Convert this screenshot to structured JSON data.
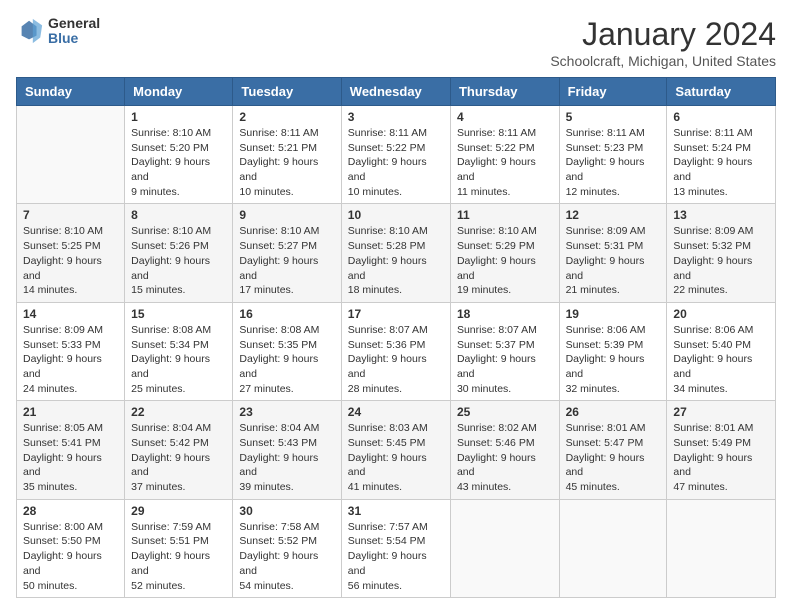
{
  "header": {
    "logo": {
      "general": "General",
      "blue": "Blue"
    },
    "title": "January 2024",
    "location": "Schoolcraft, Michigan, United States"
  },
  "calendar": {
    "weekdays": [
      "Sunday",
      "Monday",
      "Tuesday",
      "Wednesday",
      "Thursday",
      "Friday",
      "Saturday"
    ],
    "weeks": [
      [
        {
          "day": "",
          "sunrise": "",
          "sunset": "",
          "daylight": ""
        },
        {
          "day": "1",
          "sunrise": "Sunrise: 8:10 AM",
          "sunset": "Sunset: 5:20 PM",
          "daylight": "Daylight: 9 hours and 9 minutes."
        },
        {
          "day": "2",
          "sunrise": "Sunrise: 8:11 AM",
          "sunset": "Sunset: 5:21 PM",
          "daylight": "Daylight: 9 hours and 10 minutes."
        },
        {
          "day": "3",
          "sunrise": "Sunrise: 8:11 AM",
          "sunset": "Sunset: 5:22 PM",
          "daylight": "Daylight: 9 hours and 10 minutes."
        },
        {
          "day": "4",
          "sunrise": "Sunrise: 8:11 AM",
          "sunset": "Sunset: 5:22 PM",
          "daylight": "Daylight: 9 hours and 11 minutes."
        },
        {
          "day": "5",
          "sunrise": "Sunrise: 8:11 AM",
          "sunset": "Sunset: 5:23 PM",
          "daylight": "Daylight: 9 hours and 12 minutes."
        },
        {
          "day": "6",
          "sunrise": "Sunrise: 8:11 AM",
          "sunset": "Sunset: 5:24 PM",
          "daylight": "Daylight: 9 hours and 13 minutes."
        }
      ],
      [
        {
          "day": "7",
          "sunrise": "Sunrise: 8:10 AM",
          "sunset": "Sunset: 5:25 PM",
          "daylight": "Daylight: 9 hours and 14 minutes."
        },
        {
          "day": "8",
          "sunrise": "Sunrise: 8:10 AM",
          "sunset": "Sunset: 5:26 PM",
          "daylight": "Daylight: 9 hours and 15 minutes."
        },
        {
          "day": "9",
          "sunrise": "Sunrise: 8:10 AM",
          "sunset": "Sunset: 5:27 PM",
          "daylight": "Daylight: 9 hours and 17 minutes."
        },
        {
          "day": "10",
          "sunrise": "Sunrise: 8:10 AM",
          "sunset": "Sunset: 5:28 PM",
          "daylight": "Daylight: 9 hours and 18 minutes."
        },
        {
          "day": "11",
          "sunrise": "Sunrise: 8:10 AM",
          "sunset": "Sunset: 5:29 PM",
          "daylight": "Daylight: 9 hours and 19 minutes."
        },
        {
          "day": "12",
          "sunrise": "Sunrise: 8:09 AM",
          "sunset": "Sunset: 5:31 PM",
          "daylight": "Daylight: 9 hours and 21 minutes."
        },
        {
          "day": "13",
          "sunrise": "Sunrise: 8:09 AM",
          "sunset": "Sunset: 5:32 PM",
          "daylight": "Daylight: 9 hours and 22 minutes."
        }
      ],
      [
        {
          "day": "14",
          "sunrise": "Sunrise: 8:09 AM",
          "sunset": "Sunset: 5:33 PM",
          "daylight": "Daylight: 9 hours and 24 minutes."
        },
        {
          "day": "15",
          "sunrise": "Sunrise: 8:08 AM",
          "sunset": "Sunset: 5:34 PM",
          "daylight": "Daylight: 9 hours and 25 minutes."
        },
        {
          "day": "16",
          "sunrise": "Sunrise: 8:08 AM",
          "sunset": "Sunset: 5:35 PM",
          "daylight": "Daylight: 9 hours and 27 minutes."
        },
        {
          "day": "17",
          "sunrise": "Sunrise: 8:07 AM",
          "sunset": "Sunset: 5:36 PM",
          "daylight": "Daylight: 9 hours and 28 minutes."
        },
        {
          "day": "18",
          "sunrise": "Sunrise: 8:07 AM",
          "sunset": "Sunset: 5:37 PM",
          "daylight": "Daylight: 9 hours and 30 minutes."
        },
        {
          "day": "19",
          "sunrise": "Sunrise: 8:06 AM",
          "sunset": "Sunset: 5:39 PM",
          "daylight": "Daylight: 9 hours and 32 minutes."
        },
        {
          "day": "20",
          "sunrise": "Sunrise: 8:06 AM",
          "sunset": "Sunset: 5:40 PM",
          "daylight": "Daylight: 9 hours and 34 minutes."
        }
      ],
      [
        {
          "day": "21",
          "sunrise": "Sunrise: 8:05 AM",
          "sunset": "Sunset: 5:41 PM",
          "daylight": "Daylight: 9 hours and 35 minutes."
        },
        {
          "day": "22",
          "sunrise": "Sunrise: 8:04 AM",
          "sunset": "Sunset: 5:42 PM",
          "daylight": "Daylight: 9 hours and 37 minutes."
        },
        {
          "day": "23",
          "sunrise": "Sunrise: 8:04 AM",
          "sunset": "Sunset: 5:43 PM",
          "daylight": "Daylight: 9 hours and 39 minutes."
        },
        {
          "day": "24",
          "sunrise": "Sunrise: 8:03 AM",
          "sunset": "Sunset: 5:45 PM",
          "daylight": "Daylight: 9 hours and 41 minutes."
        },
        {
          "day": "25",
          "sunrise": "Sunrise: 8:02 AM",
          "sunset": "Sunset: 5:46 PM",
          "daylight": "Daylight: 9 hours and 43 minutes."
        },
        {
          "day": "26",
          "sunrise": "Sunrise: 8:01 AM",
          "sunset": "Sunset: 5:47 PM",
          "daylight": "Daylight: 9 hours and 45 minutes."
        },
        {
          "day": "27",
          "sunrise": "Sunrise: 8:01 AM",
          "sunset": "Sunset: 5:49 PM",
          "daylight": "Daylight: 9 hours and 47 minutes."
        }
      ],
      [
        {
          "day": "28",
          "sunrise": "Sunrise: 8:00 AM",
          "sunset": "Sunset: 5:50 PM",
          "daylight": "Daylight: 9 hours and 50 minutes."
        },
        {
          "day": "29",
          "sunrise": "Sunrise: 7:59 AM",
          "sunset": "Sunset: 5:51 PM",
          "daylight": "Daylight: 9 hours and 52 minutes."
        },
        {
          "day": "30",
          "sunrise": "Sunrise: 7:58 AM",
          "sunset": "Sunset: 5:52 PM",
          "daylight": "Daylight: 9 hours and 54 minutes."
        },
        {
          "day": "31",
          "sunrise": "Sunrise: 7:57 AM",
          "sunset": "Sunset: 5:54 PM",
          "daylight": "Daylight: 9 hours and 56 minutes."
        },
        {
          "day": "",
          "sunrise": "",
          "sunset": "",
          "daylight": ""
        },
        {
          "day": "",
          "sunrise": "",
          "sunset": "",
          "daylight": ""
        },
        {
          "day": "",
          "sunrise": "",
          "sunset": "",
          "daylight": ""
        }
      ]
    ]
  }
}
